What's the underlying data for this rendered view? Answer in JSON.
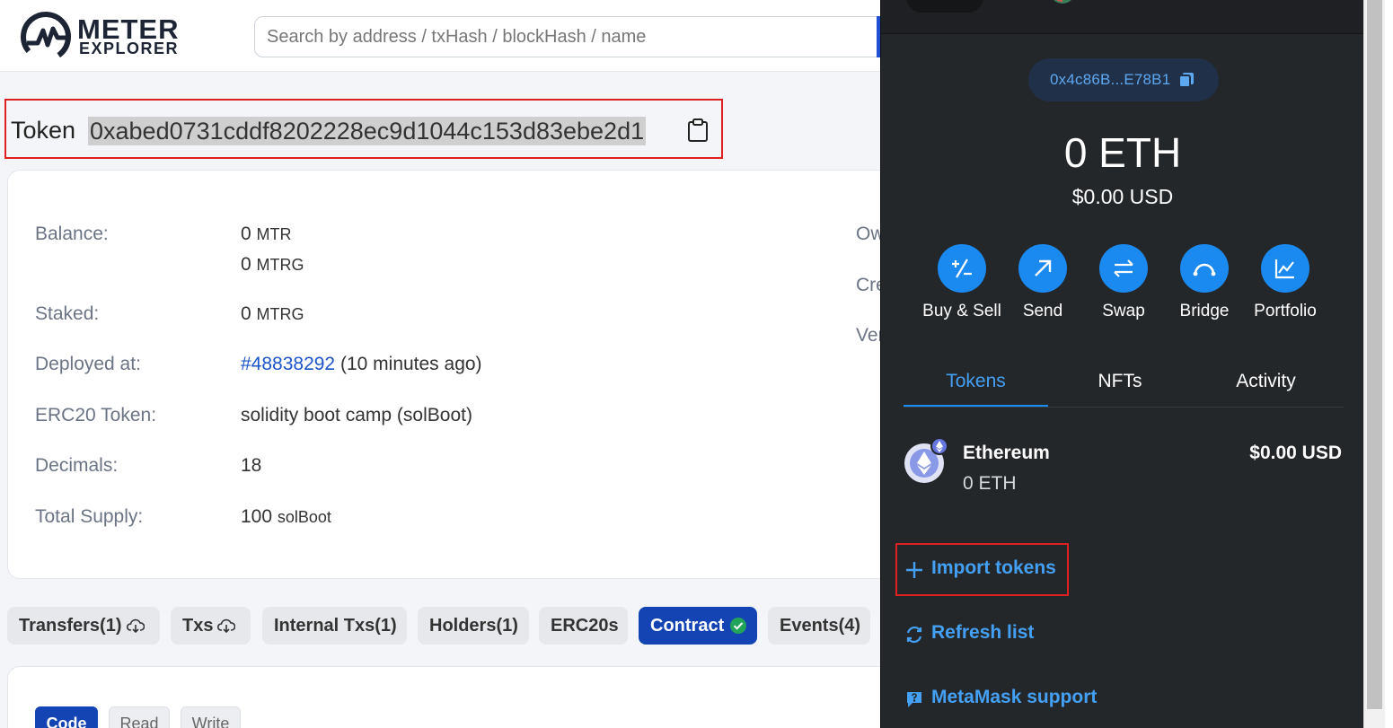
{
  "header": {
    "logo_word1": "METER",
    "logo_word2": "EXPLORER",
    "search_placeholder": "Search by address / txHash / blockHash / name"
  },
  "token": {
    "label": "Token",
    "address": "0xabed0731cddf8202228ec9d1044c153d83ebe2d1"
  },
  "details": {
    "balance_label": "Balance:",
    "balance_mtr": "0",
    "balance_mtr_unit": "MTR",
    "balance_mtrg": "0",
    "balance_mtrg_unit": "MTRG",
    "staked_label": "Staked:",
    "staked_value": "0",
    "staked_unit": "MTRG",
    "deployed_label": "Deployed at:",
    "deployed_block": "#48838292",
    "deployed_ago": "(10 minutes ago)",
    "erc20_label": "ERC20 Token:",
    "erc20_value": "solidity boot camp (solBoot)",
    "decimals_label": "Decimals:",
    "decimals_value": "18",
    "supply_label": "Total Supply:",
    "supply_value": "100",
    "supply_unit": "solBoot",
    "side_1": "Ow",
    "side_2": "Cre",
    "side_3": "Ver"
  },
  "tabs": [
    "Transfers(1)",
    "Txs",
    "Internal Txs(1)",
    "Holders(1)",
    "ERC20s",
    "Contract",
    "Events(4)"
  ],
  "subtabs": [
    "Code",
    "Read",
    "Write"
  ],
  "colors": {
    "primary": "#1443b4",
    "link": "#1b55c9",
    "highlight_border": "#e02020",
    "metamask_bg": "#24272a",
    "metamask_accent": "#1a89f0",
    "verified": "#22a35a"
  },
  "metamask": {
    "address_short": "0x4c86B...E78B1",
    "balance": "0 ETH",
    "balance_usd": "$0.00 USD",
    "actions": [
      "Buy & Sell",
      "Send",
      "Swap",
      "Bridge",
      "Portfolio"
    ],
    "tabs": [
      "Tokens",
      "NFTs",
      "Activity"
    ],
    "active_tab": "Tokens",
    "asset_name": "Ethereum",
    "asset_amount": "0 ETH",
    "asset_usd": "$0.00 USD",
    "import_tokens": "Import tokens",
    "refresh_list": "Refresh list",
    "support": "MetaMask support"
  }
}
